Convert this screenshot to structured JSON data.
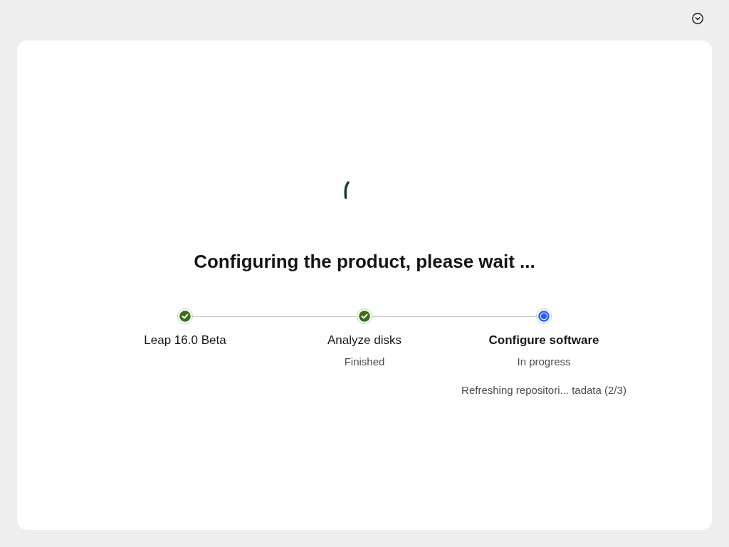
{
  "title": "Configuring the product, please wait ...",
  "steps": [
    {
      "label": "Leap 16.0 Beta",
      "kind": "done"
    },
    {
      "label": "Analyze disks",
      "kind": "done",
      "status": "Finished"
    },
    {
      "label": "Configure software",
      "kind": "current",
      "status": "In progress",
      "detail": "Refreshing repositori... tadata (2/3)"
    }
  ]
}
